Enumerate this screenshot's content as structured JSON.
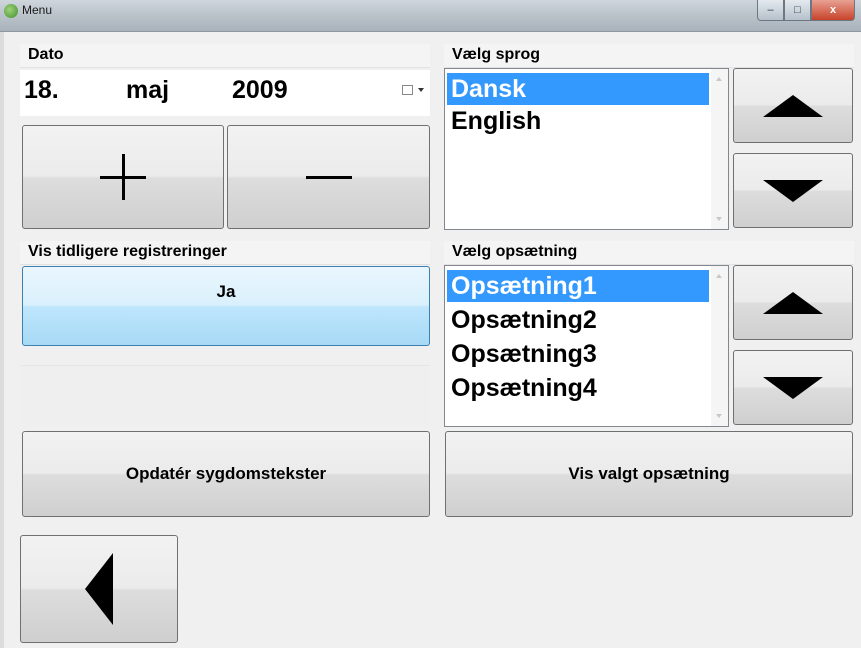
{
  "window": {
    "title": "Menu",
    "controls": {
      "minimize": "–",
      "maximize": "□",
      "close": "x"
    }
  },
  "date_section": {
    "label": "Dato",
    "day": "18.",
    "month": "maj",
    "year": "2009",
    "plus_icon": "plus-icon",
    "minus_icon": "minus-icon"
  },
  "language_section": {
    "label": "Vælg sprog",
    "items": [
      {
        "label": "Dansk",
        "selected": true
      },
      {
        "label": "English",
        "selected": false
      }
    ]
  },
  "history_section": {
    "label": "Vis tidligere registreringer",
    "button_label": "Ja"
  },
  "setup_section": {
    "label": "Vælg opsætning",
    "items": [
      {
        "label": "Opsætning1",
        "selected": true
      },
      {
        "label": "Opsætning2",
        "selected": false
      },
      {
        "label": "Opsætning3",
        "selected": false
      },
      {
        "label": "Opsætning4",
        "selected": false
      }
    ]
  },
  "actions": {
    "update_label": "Opdatér sygdomstekster",
    "show_setup_label": "Vis valgt opsætning"
  },
  "colors": {
    "selection": "#3399ff",
    "window_bg": "#f0f0f0",
    "blue_button": "#bee6fd"
  }
}
